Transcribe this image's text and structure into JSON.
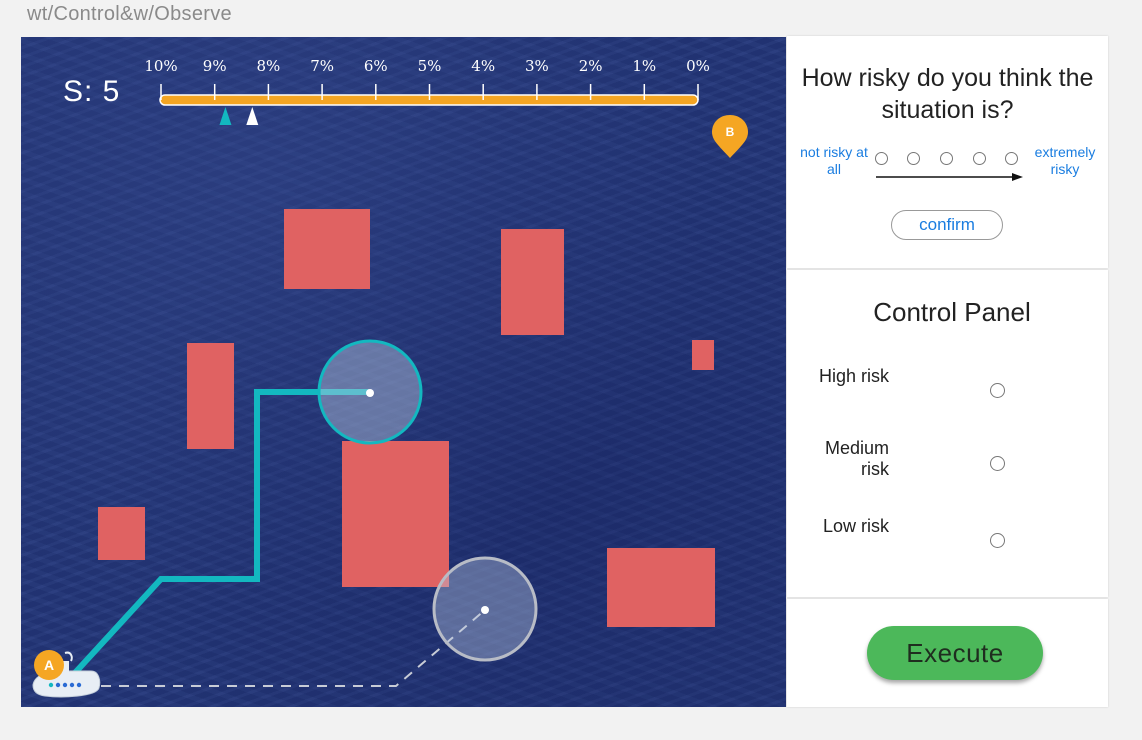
{
  "page": {
    "title": "wt/Control&w/Observe"
  },
  "map": {
    "score_label": "S: 5",
    "risk_bar": {
      "ticks": [
        "10%",
        "9%",
        "8%",
        "7%",
        "6%",
        "5%",
        "4%",
        "3%",
        "2%",
        "1%",
        "0%"
      ],
      "teal_marker_percent": 8.8,
      "white_marker_percent": 8.3
    },
    "start_marker": "A",
    "goal_marker": "B",
    "colors": {
      "ocean": "#23367a",
      "obstacle": "#e06262",
      "path": "#13b8c0",
      "bar": "#f4a523",
      "marker": "#f5a623"
    }
  },
  "risk_question": {
    "question": "How risky do you think the situation is?",
    "left_label": "not risky at all",
    "right_label": "extremely risky",
    "option_count": 5,
    "confirm_label": "confirm"
  },
  "control_panel": {
    "title": "Control Panel",
    "options": [
      "High risk",
      "Medium risk",
      "Low risk"
    ]
  },
  "execute": {
    "label": "Execute",
    "color": "#4cb85a"
  }
}
